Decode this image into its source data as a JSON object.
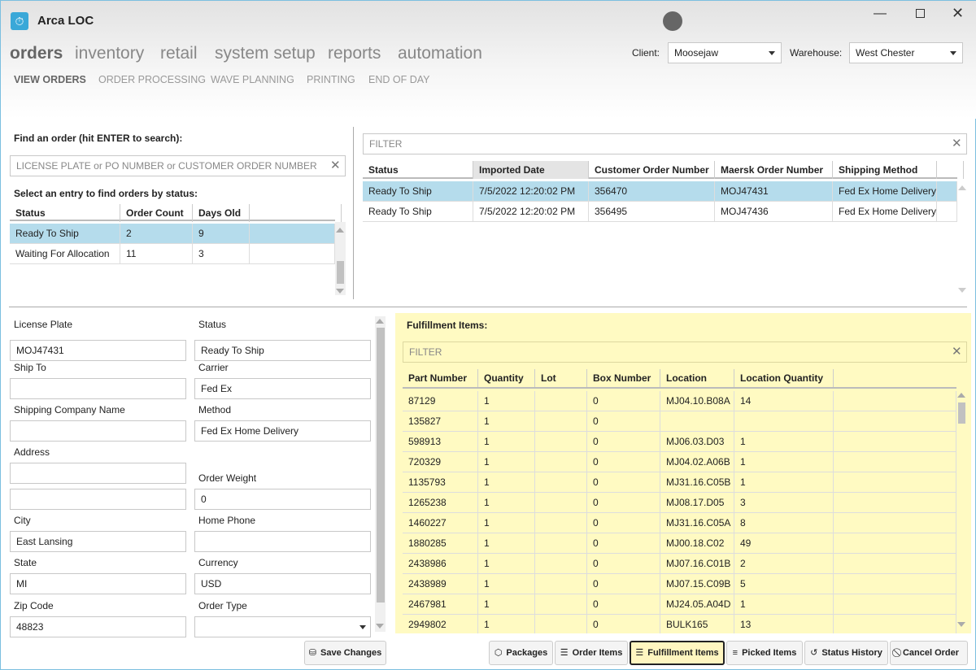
{
  "app": {
    "title": "Arca LOC"
  },
  "nav": {
    "main": [
      "orders",
      "inventory",
      "retail",
      "system setup",
      "reports",
      "automation"
    ],
    "sub": [
      "VIEW ORDERS",
      "ORDER PROCESSING",
      "WAVE PLANNING",
      "PRINTING",
      "END OF DAY"
    ]
  },
  "client": {
    "label": "Client:",
    "value": "Moosejaw"
  },
  "warehouse": {
    "label": "Warehouse:",
    "value": "West Chester"
  },
  "find": {
    "label": "Find an order (hit ENTER to search):",
    "placeholder": "LICENSE PLATE or PO NUMBER or CUSTOMER ORDER NUMBER",
    "status_label": "Select an entry to find orders by status:"
  },
  "status_table": {
    "headers": [
      "Status",
      "Order Count",
      "Days Old"
    ],
    "rows": [
      [
        "Ready To Ship",
        "2",
        "9"
      ],
      [
        "Waiting For Allocation",
        "11",
        "3"
      ]
    ]
  },
  "orders_table": {
    "filter_placeholder": "FILTER",
    "headers": [
      "Status",
      "Imported Date",
      "Customer Order Number",
      "Maersk Order Number",
      "Shipping Method"
    ],
    "rows": [
      [
        "Ready To Ship",
        "7/5/2022 12:20:02 PM",
        "356470",
        "MOJ47431",
        "Fed Ex Home Delivery"
      ],
      [
        "Ready To Ship",
        "7/5/2022 12:20:02 PM",
        "356495",
        "MOJ47436",
        "Fed Ex Home Delivery"
      ]
    ]
  },
  "form": {
    "license_plate": {
      "label": "License Plate",
      "value": "MOJ47431"
    },
    "status": {
      "label": "Status",
      "value": "Ready To Ship"
    },
    "ship_to": {
      "label": "Ship To",
      "value": ""
    },
    "carrier": {
      "label": "Carrier",
      "value": "Fed Ex"
    },
    "shipping_company": {
      "label": "Shipping Company Name",
      "value": ""
    },
    "method": {
      "label": "Method",
      "value": "Fed Ex Home Delivery"
    },
    "address": {
      "label": "Address",
      "value1": "",
      "value2": ""
    },
    "order_weight": {
      "label": "Order Weight",
      "value": "0"
    },
    "city": {
      "label": "City",
      "value": "East Lansing"
    },
    "home_phone": {
      "label": "Home Phone",
      "value": ""
    },
    "state": {
      "label": "State",
      "value": "MI"
    },
    "currency": {
      "label": "Currency",
      "value": "USD"
    },
    "zip": {
      "label": "Zip Code",
      "value": "48823"
    },
    "order_type": {
      "label": "Order Type",
      "value": ""
    },
    "save_label": "Save Changes"
  },
  "fulfillment": {
    "title": "Fulfillment Items:",
    "filter_placeholder": "FILTER",
    "headers": [
      "Part Number",
      "Quantity",
      "Lot",
      "Box Number",
      "Location",
      "Location Quantity"
    ],
    "rows": [
      [
        "87129",
        "1",
        "",
        "0",
        "MJ04.10.B08A",
        "14"
      ],
      [
        "135827",
        "1",
        "",
        "0",
        "",
        ""
      ],
      [
        "598913",
        "1",
        "",
        "0",
        "MJ06.03.D03",
        "1"
      ],
      [
        "720329",
        "1",
        "",
        "0",
        "MJ04.02.A06B",
        "1"
      ],
      [
        "1135793",
        "1",
        "",
        "0",
        "MJ31.16.C05B",
        "1"
      ],
      [
        "1265238",
        "1",
        "",
        "0",
        "MJ08.17.D05",
        "3"
      ],
      [
        "1460227",
        "1",
        "",
        "0",
        "MJ31.16.C05A",
        "8"
      ],
      [
        "1880285",
        "1",
        "",
        "0",
        "MJ00.18.C02",
        "49"
      ],
      [
        "2438986",
        "1",
        "",
        "0",
        "MJ07.16.C01B",
        "2"
      ],
      [
        "2438989",
        "1",
        "",
        "0",
        "MJ07.15.C09B",
        "5"
      ],
      [
        "2467981",
        "1",
        "",
        "0",
        "MJ24.05.A04D",
        "1"
      ],
      [
        "2949802",
        "1",
        "",
        "0",
        "BULK165",
        "13"
      ]
    ]
  },
  "buttons": [
    {
      "label": "Packages",
      "icon": "package-icon",
      "glyph": "⬡"
    },
    {
      "label": "Order Items",
      "icon": "list-icon",
      "glyph": "☰"
    },
    {
      "label": "Fulfillment Items",
      "icon": "checklist-icon",
      "glyph": "☰",
      "active": true
    },
    {
      "label": "Picked Items",
      "icon": "list-check-icon",
      "glyph": "≡"
    },
    {
      "label": "Status History",
      "icon": "history-icon",
      "glyph": "↺"
    },
    {
      "label": "Cancel Order",
      "icon": "cancel-icon",
      "glyph": "⃠"
    }
  ],
  "colors": {
    "accent": "#3aa8d8",
    "selected_row": "#b5dcec",
    "fulfillment_bg": "#fffac2"
  }
}
